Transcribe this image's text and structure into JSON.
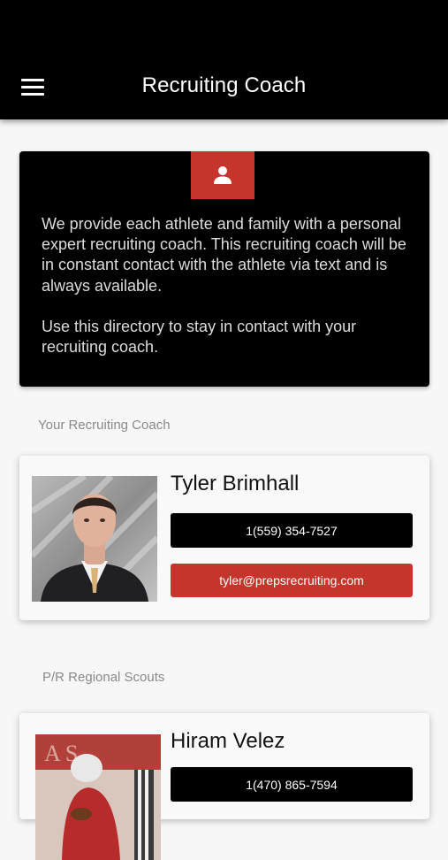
{
  "header": {
    "title": "Recruiting Coach",
    "menu_icon": "hamburger-menu-icon"
  },
  "intro": {
    "icon": "person-icon",
    "paragraph_1": "We provide each athlete and family with a personal expert recruiting coach. This recruiting coach will be in constant contact with the athlete via text and is always available.",
    "paragraph_2": "Use this directory to stay in contact with your recruiting coach."
  },
  "sections": {
    "your_coach_label": "Your Recruiting Coach",
    "regional_scouts_label": "P/R Regional Scouts"
  },
  "coach": {
    "name": "Tyler Brimhall",
    "phone": "1(559) 354-7527",
    "email": "tyler@prepsrecruiting.com"
  },
  "scout": {
    "name": "Hiram Velez",
    "phone": "1(470) 865-7594"
  },
  "colors": {
    "accent_red": "#c6352b",
    "header_black": "#000000",
    "background": "#f7f7f7"
  }
}
